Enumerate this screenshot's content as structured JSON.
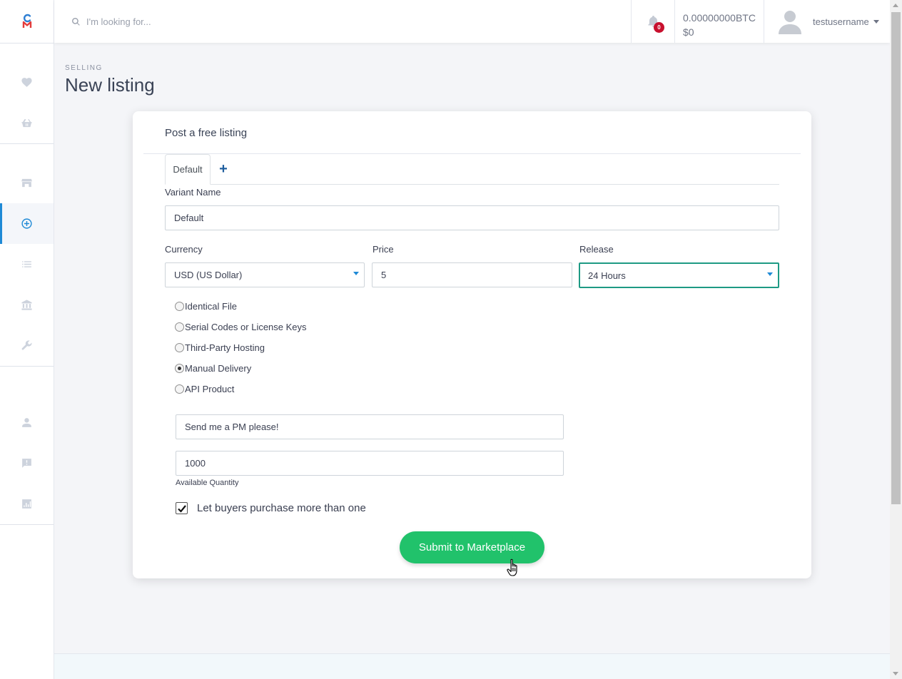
{
  "topbar": {
    "search_placeholder": "I'm looking for...",
    "notification_count": "0",
    "balance_btc": "0.00000000BTC",
    "balance_usd": "$0",
    "username": "testusername"
  },
  "page": {
    "overline": "SELLING",
    "title": "New listing"
  },
  "card": {
    "title": "Post a free listing",
    "tabs": [
      {
        "label": "Default"
      }
    ],
    "add_tab_label": "+",
    "variant_name_label": "Variant Name",
    "variant_name_value": "Default",
    "currency_label": "Currency",
    "currency_value": "USD (US Dollar)",
    "price_label": "Price",
    "price_value": "5",
    "release_label": "Release",
    "release_value": "24 Hours",
    "delivery_options": [
      {
        "label": "Identical File",
        "checked": false
      },
      {
        "label": "Serial Codes or License Keys",
        "checked": false
      },
      {
        "label": "Third-Party Hosting",
        "checked": false
      },
      {
        "label": "Manual Delivery",
        "checked": true
      },
      {
        "label": "API Product",
        "checked": false
      }
    ],
    "manual_delivery_message": "Send me a PM please!",
    "quantity_value": "1000",
    "quantity_label": "Available Quantity",
    "multi_purchase_label": "Let buyers purchase more than one",
    "multi_purchase_checked": true,
    "submit_label": "Submit to Marketplace"
  },
  "sidebar": {
    "items": [
      {
        "icon": "heart-icon"
      },
      {
        "icon": "basket-icon"
      },
      {
        "icon": "store-icon"
      },
      {
        "icon": "plus-circle-icon",
        "active": true
      },
      {
        "icon": "list-icon"
      },
      {
        "icon": "bank-icon"
      },
      {
        "icon": "wrench-icon"
      },
      {
        "icon": "user-icon"
      },
      {
        "icon": "chat-alert-icon"
      },
      {
        "icon": "chart-icon"
      }
    ]
  },
  "colors": {
    "accent": "#1f8ad6",
    "submit": "#21c26b",
    "focus_border": "#1e9a84",
    "badge": "#c8102e"
  }
}
